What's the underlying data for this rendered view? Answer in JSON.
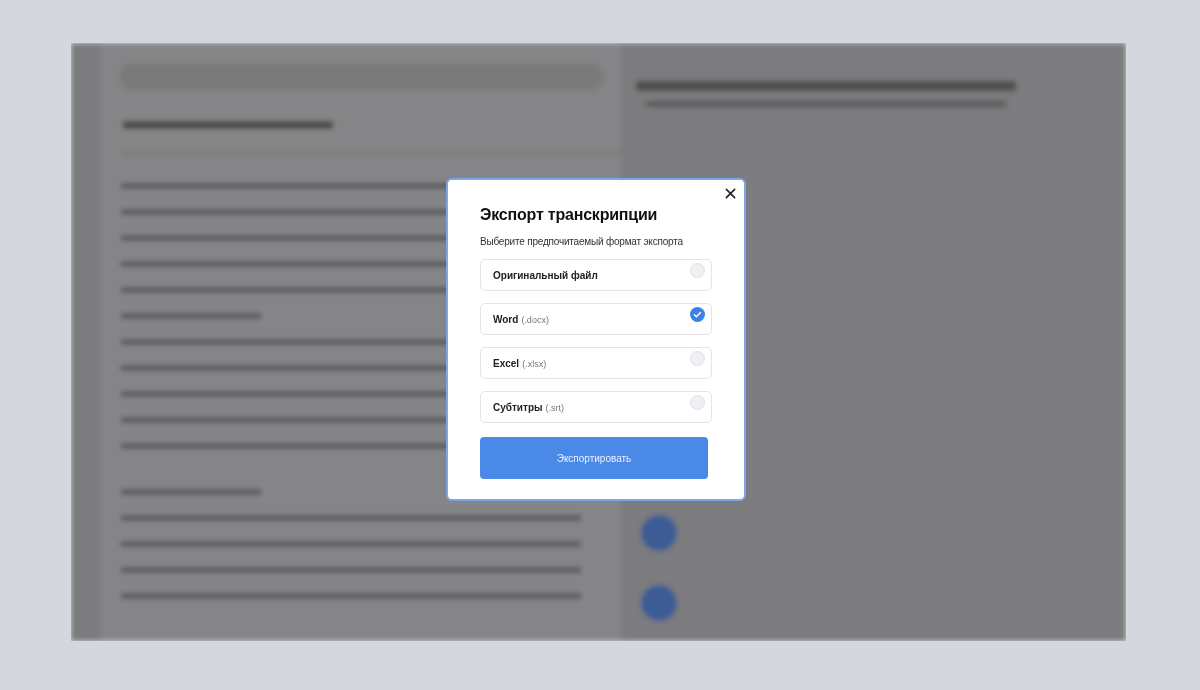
{
  "dialog": {
    "title": "Экспорт транскрипции",
    "subtitle": "Выберите предпочитаемый формат экспорта",
    "options": [
      {
        "label": "Оригинальный файл",
        "selected": false
      },
      {
        "label": "Word",
        "extension": "(.docx)",
        "selected": true
      },
      {
        "label": "Excel",
        "extension": "(.xlsx)",
        "selected": false
      },
      {
        "label": "Субтитры",
        "extension": "(.srt)",
        "selected": false
      }
    ],
    "button": "Экспортировать"
  }
}
